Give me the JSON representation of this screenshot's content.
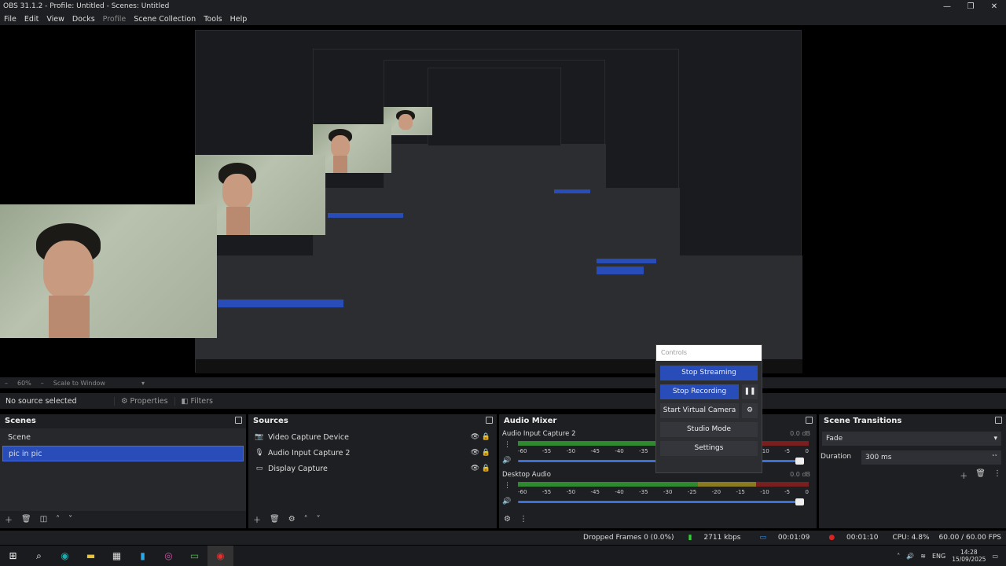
{
  "window": {
    "title": "OBS 31.1.2 - Profile: Untitled - Scenes: Untitled",
    "min": "—",
    "max": "❐",
    "close": "✕"
  },
  "menu": [
    "File",
    "Edit",
    "View",
    "Docks",
    "Profile",
    "Scene Collection",
    "Tools",
    "Help"
  ],
  "zoombar": {
    "zoom": "60%",
    "scale": "Scale to Window"
  },
  "propbar": {
    "no_source": "No source selected",
    "properties": "Properties",
    "filters": "Filters"
  },
  "scenes": {
    "title": "Scenes",
    "items": [
      "Scene",
      "pic in pic"
    ],
    "selected": 1
  },
  "sources": {
    "title": "Sources",
    "items": [
      {
        "icon": "camera-icon",
        "label": "Video Capture Device"
      },
      {
        "icon": "microphone-icon",
        "label": "Audio Input Capture 2"
      },
      {
        "icon": "monitor-icon",
        "label": "Display Capture"
      }
    ]
  },
  "mixer": {
    "title": "Audio Mixer",
    "channels": [
      {
        "name": "Audio Input Capture 2",
        "db": "0.0 dB"
      },
      {
        "name": "Desktop Audio",
        "db": "0.0 dB"
      }
    ],
    "ticks": [
      "-60",
      "-55",
      "-50",
      "-45",
      "-40",
      "-35",
      "-30",
      "-25",
      "-20",
      "-15",
      "-10",
      "-5",
      "0"
    ]
  },
  "controls": {
    "title": "Controls",
    "stop_streaming": "Stop Streaming",
    "stop_recording": "Stop Recording",
    "start_virtual": "Start Virtual Camera",
    "studio_mode": "Studio Mode",
    "settings": "Settings"
  },
  "transitions": {
    "title": "Scene Transitions",
    "type": "Fade",
    "duration_label": "Duration",
    "duration": "300 ms"
  },
  "status": {
    "dropped": "Dropped Frames 0 (0.0%)",
    "kbps": "2711 kbps",
    "stream_time": "00:01:09",
    "rec_time": "00:01:10",
    "cpu": "CPU: 4.8%",
    "fps": "60.00 / 60.00 FPS"
  },
  "taskbar": {
    "lang": "ENG",
    "time": "14:28",
    "date": "15/09/2025"
  },
  "colors": {
    "accent": "#284cb8",
    "bg": "#1e1f22",
    "panel": "#26282c"
  }
}
